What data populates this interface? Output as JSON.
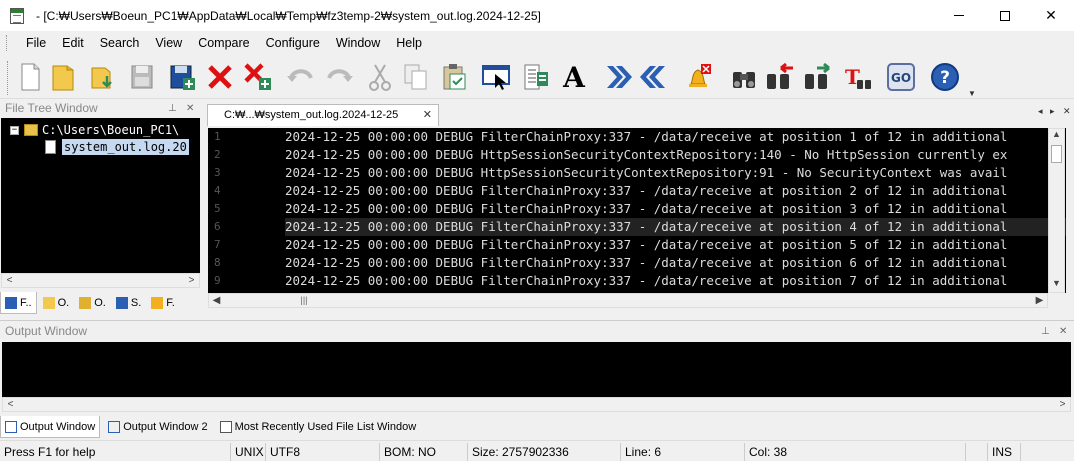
{
  "window": {
    "title": "- [C:₩Users₩Boeun_PC1₩AppData₩Local₩Temp₩fz3temp-2₩system_out.log.2024-12-25]"
  },
  "menu": [
    "File",
    "Edit",
    "Search",
    "View",
    "Compare",
    "Configure",
    "Window",
    "Help"
  ],
  "toolbar": {
    "buttons": [
      "new-file",
      "open-folder",
      "open-recent",
      "save",
      "save-all",
      "close",
      "close-all",
      "undo",
      "redo",
      "cut",
      "copy",
      "paste",
      "find-in-window",
      "compare",
      "font",
      "next-difference",
      "previous-difference",
      "alert",
      "find",
      "find-previous",
      "find-next",
      "find-in-files",
      "go",
      "help"
    ],
    "font_letter": "A",
    "go_label": "GO",
    "help_label": "?"
  },
  "file_tree": {
    "title": "File Tree Window",
    "root": "C:\\Users\\Boeun_PC1\\",
    "file": "system_out.log.20",
    "tabs": [
      "F..",
      "O.",
      "O.",
      "S.",
      "F."
    ]
  },
  "editor": {
    "tab_label": "C:₩...₩system_out.log.2024-12-25",
    "current_line_index": 5,
    "lines": [
      {
        "n": "1",
        "text": "2024-12-25 00:00:00 DEBUG FilterChainProxy:337 - /data/receive at position 1 of 12 in additional"
      },
      {
        "n": "2",
        "text": "2024-12-25 00:00:00 DEBUG HttpSessionSecurityContextRepository:140 - No HttpSession currently ex"
      },
      {
        "n": "3",
        "text": "2024-12-25 00:00:00 DEBUG HttpSessionSecurityContextRepository:91 - No SecurityContext was avail"
      },
      {
        "n": "4",
        "text": "2024-12-25 00:00:00 DEBUG FilterChainProxy:337 - /data/receive at position 2 of 12 in additional"
      },
      {
        "n": "5",
        "text": "2024-12-25 00:00:00 DEBUG FilterChainProxy:337 - /data/receive at position 3 of 12 in additional"
      },
      {
        "n": "6",
        "text": "2024-12-25 00:00:00 DEBUG FilterChainProxy:337 - /data/receive at position 4 of 12 in additional"
      },
      {
        "n": "7",
        "text": "2024-12-25 00:00:00 DEBUG FilterChainProxy:337 - /data/receive at position 5 of 12 in additional"
      },
      {
        "n": "8",
        "text": "2024-12-25 00:00:00 DEBUG FilterChainProxy:337 - /data/receive at position 6 of 12 in additional"
      },
      {
        "n": "9",
        "text": "2024-12-25 00:00:00 DEBUG FilterChainProxy:337 - /data/receive at position 7 of 12 in additional"
      }
    ]
  },
  "output": {
    "title": "Output Window",
    "tabs": [
      "Output Window",
      "Output Window 2",
      "Most Recently Used File List Window"
    ]
  },
  "status": {
    "help": "Press F1 for help",
    "eol": "UNIX",
    "encoding": "UTF8",
    "bom": "BOM: NO",
    "size": "Size: 2757902336",
    "line": "Line: 6",
    "col": "Col: 38",
    "mode": "INS"
  }
}
